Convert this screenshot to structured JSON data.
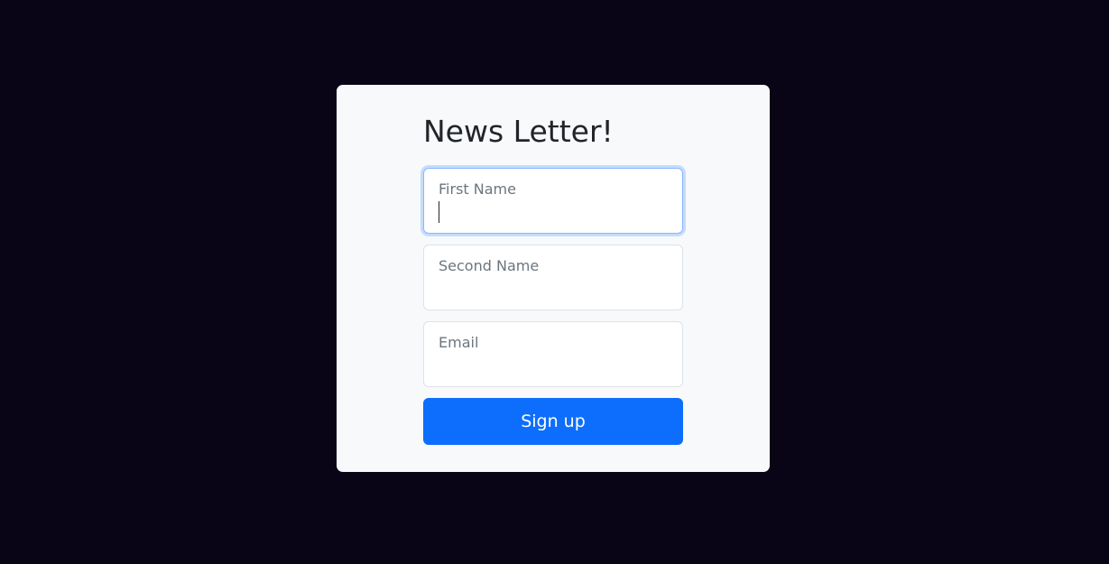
{
  "form": {
    "title": "News Letter!",
    "fields": [
      {
        "label": "First Name",
        "value": "",
        "focused": true
      },
      {
        "label": "Second Name",
        "value": ""
      },
      {
        "label": "Email",
        "value": ""
      }
    ],
    "submit_label": "Sign up"
  },
  "colors": {
    "page_background": "#0a0417",
    "card_background": "#f8f9fa",
    "button": "#0d6efd",
    "focus_ring": "#86b7fe"
  }
}
